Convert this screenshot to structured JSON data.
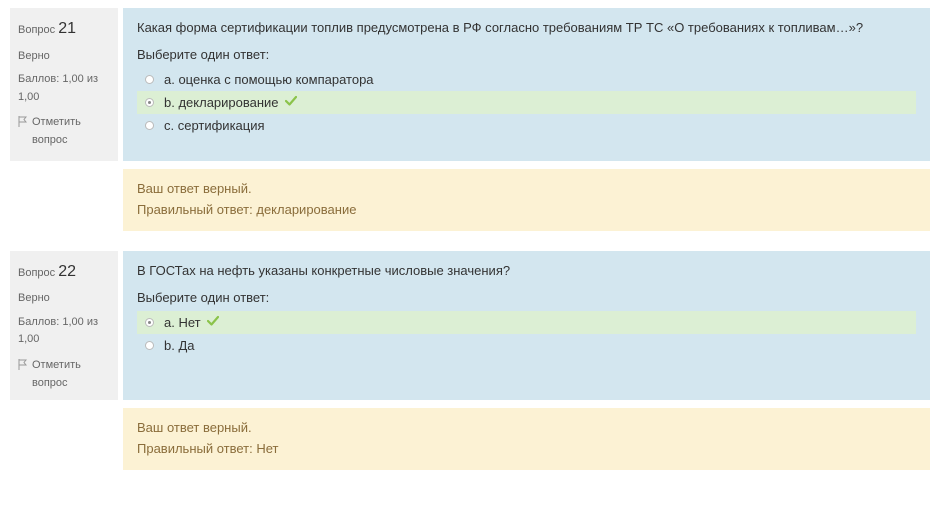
{
  "questions": [
    {
      "label": "Вопрос",
      "number": "21",
      "status": "Верно",
      "score": "Баллов: 1,00 из 1,00",
      "flag_label": "Отметить вопрос",
      "text": "Какая форма сертификации топлив предусмотрена в РФ согласно требованиям ТР ТС «О требованиях к топливам…»?",
      "prompt": "Выберите один ответ:",
      "options": [
        {
          "label": "a. оценка с помощью компаратора",
          "selected": false,
          "correct": false
        },
        {
          "label": "b. декларирование",
          "selected": true,
          "correct": true
        },
        {
          "label": "c. сертификация",
          "selected": false,
          "correct": false
        }
      ],
      "feedback_line1": "Ваш ответ верный.",
      "feedback_line2": "Правильный ответ: декларирование"
    },
    {
      "label": "Вопрос",
      "number": "22",
      "status": "Верно",
      "score": "Баллов: 1,00 из 1,00",
      "flag_label": "Отметить вопрос",
      "text": "В ГОСТах на нефть указаны конкретные числовые значения?",
      "prompt": "Выберите один ответ:",
      "options": [
        {
          "label": "a. Нет",
          "selected": true,
          "correct": true
        },
        {
          "label": "b. Да",
          "selected": false,
          "correct": false
        }
      ],
      "feedback_line1": "Ваш ответ верный.",
      "feedback_line2": "Правильный ответ: Нет"
    }
  ]
}
